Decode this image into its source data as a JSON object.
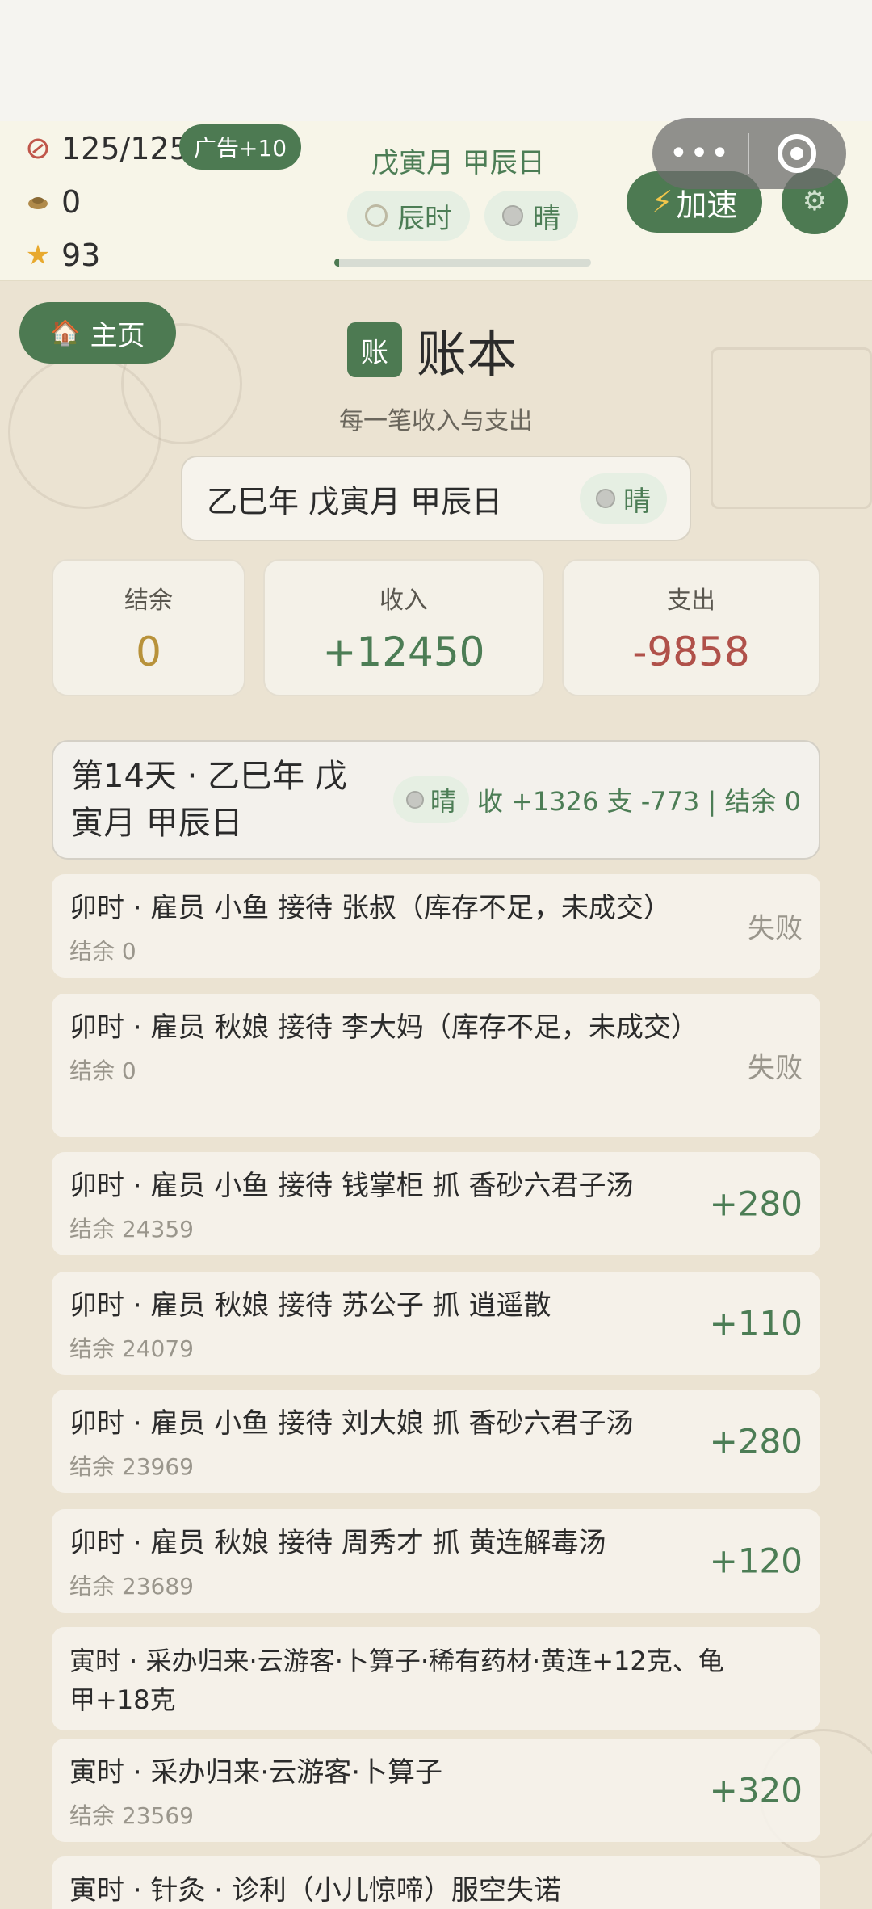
{
  "status": {
    "energy": "125/125",
    "ad_label": "广告+10",
    "coins": "0",
    "stars": "93",
    "date": "戊寅月 甲辰日",
    "time_chip": "辰时",
    "weather_chip": "晴",
    "time_progress": 0.02,
    "speed_label": "加速"
  },
  "nav": {
    "home_label": "主页"
  },
  "page": {
    "badge": "账",
    "title": "账本",
    "subtitle": "每一笔收入与支出",
    "date": "乙巳年 戊寅月 甲辰日",
    "weather": "晴"
  },
  "summary": [
    {
      "label": "结余",
      "value": "0",
      "color": "#b8923a"
    },
    {
      "label": "收入",
      "value": "+12450",
      "color": "#4c7d55"
    },
    {
      "label": "支出",
      "value": "-9858",
      "color": "#b0514a"
    }
  ],
  "day": {
    "title": "第14天 · 乙巳年 戊寅月 甲辰日",
    "weather": "晴",
    "stats": "收 +1326  支 -773  |  结余 0"
  },
  "records": [
    {
      "text": "卯时 · 雇员 小鱼 接待 张叔（库存不足，未成交）",
      "balance": "结余 0",
      "result": "失败"
    },
    {
      "text": "卯时 · 雇员 秋娘 接待 李大妈（库存不足，未成交）",
      "balance": "结余 0",
      "result": "失败"
    },
    {
      "text": "卯时 · 雇员 小鱼 接待 钱掌柜 抓 香砂六君子汤",
      "balance": "结余 24359",
      "result": "+280"
    },
    {
      "text": "卯时 · 雇员 秋娘 接待 苏公子 抓 逍遥散",
      "balance": "结余 24079",
      "result": "+110"
    },
    {
      "text": "卯时 · 雇员 小鱼 接待 刘大娘 抓 香砂六君子汤",
      "balance": "结余 23969",
      "result": "+280"
    },
    {
      "text": "卯时 · 雇员 秋娘 接待 周秀才 抓 黄连解毒汤",
      "balance": "结余 23689",
      "result": "+120"
    },
    {
      "text": "寅时 · 采办归来·云游客·卜算子·稀有药材·黄连+12克、龟甲+18克",
      "balance": "",
      "result": ""
    },
    {
      "text": "寅时 · 采办归来·云游客·卜算子",
      "balance": "结余 23569",
      "result": "+320"
    },
    {
      "text": "寅时 · 针灸 · 诊利（小儿惊啼）服空失诺",
      "balance": "",
      "result": ""
    }
  ]
}
